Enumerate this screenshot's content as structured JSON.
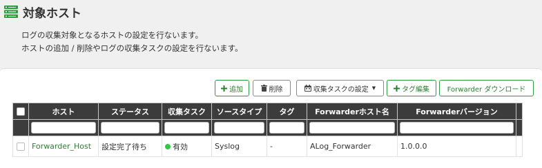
{
  "header": {
    "title": "対象ホスト",
    "title_icon": "server-list-icon",
    "accent_color": "#2e9a3e"
  },
  "description": {
    "line1": "ログの収集対象となるホストの設定を行ないます。",
    "line2": "ホストの追加 / 削除やログの収集タスクの設定を行ないます。"
  },
  "toolbar": {
    "add_label": "追加",
    "delete_label": "削除",
    "collect_task_label": "収集タスクの設定",
    "tag_edit_label": "タグ編集",
    "forwarder_download_label": "Forwarder ダウンロード"
  },
  "table": {
    "columns": [
      "ホスト",
      "ステータス",
      "収集タスク",
      "ソースタイプ",
      "タグ",
      "Forwarderホスト名",
      "Forwarderバージョン"
    ],
    "rows": [
      {
        "host": "Forwarder_Host",
        "status": "設定完了待ち",
        "task": "有効",
        "source_type": "Syslog",
        "tag": "-",
        "forwarder_host": "ALog_Forwarder",
        "forwarder_version": "1.0.0.0"
      }
    ]
  }
}
